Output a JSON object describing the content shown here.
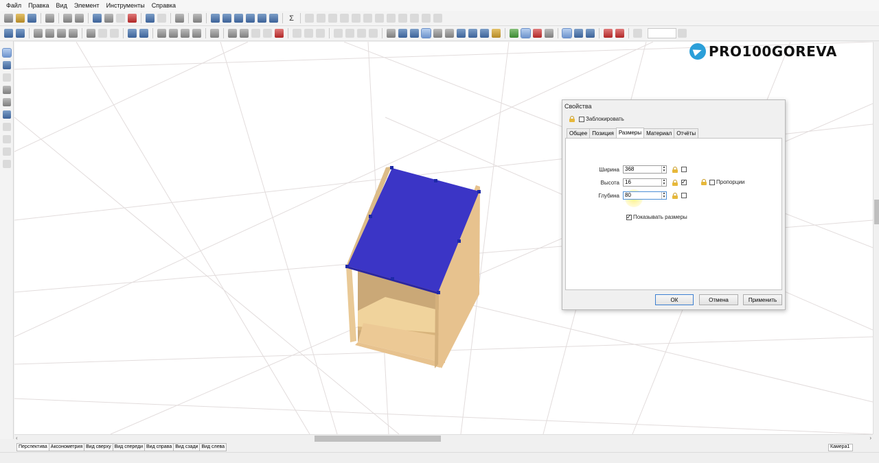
{
  "menubar": {
    "items": [
      "Файл",
      "Правка",
      "Вид",
      "Элемент",
      "Инструменты",
      "Справка"
    ]
  },
  "toolbar": {
    "sigma": "Σ"
  },
  "logo": {
    "text": "PRO100GOREVA"
  },
  "dialog": {
    "title": "Свойства",
    "lock_label": "Заблокировать",
    "tabs": [
      "Общее",
      "Позиция",
      "Размеры",
      "Материал",
      "Отчёты"
    ],
    "active_tab": "Размеры",
    "fields": {
      "width": {
        "label": "Ширина",
        "value": "368"
      },
      "height": {
        "label": "Высота",
        "value": "16"
      },
      "depth": {
        "label": "Глубина",
        "value": "80"
      }
    },
    "proportions_label": "Пропорции",
    "show_dims_label": "Показывать размеры",
    "show_dims_checked": true,
    "buttons": {
      "ok": "ОК",
      "cancel": "Отмена",
      "apply": "Применить"
    }
  },
  "view_tabs": [
    "Перспектива",
    "Аксонометрия",
    "Вид сверху",
    "Вид спереди",
    "Вид справа",
    "Вид сзади",
    "Вид слева"
  ],
  "active_view": "Перспектива",
  "camera": "Камера1",
  "colors": {
    "selected_panel": "#3b35c6",
    "wood": "#e9c48a",
    "accent": "#2b9fd9"
  }
}
